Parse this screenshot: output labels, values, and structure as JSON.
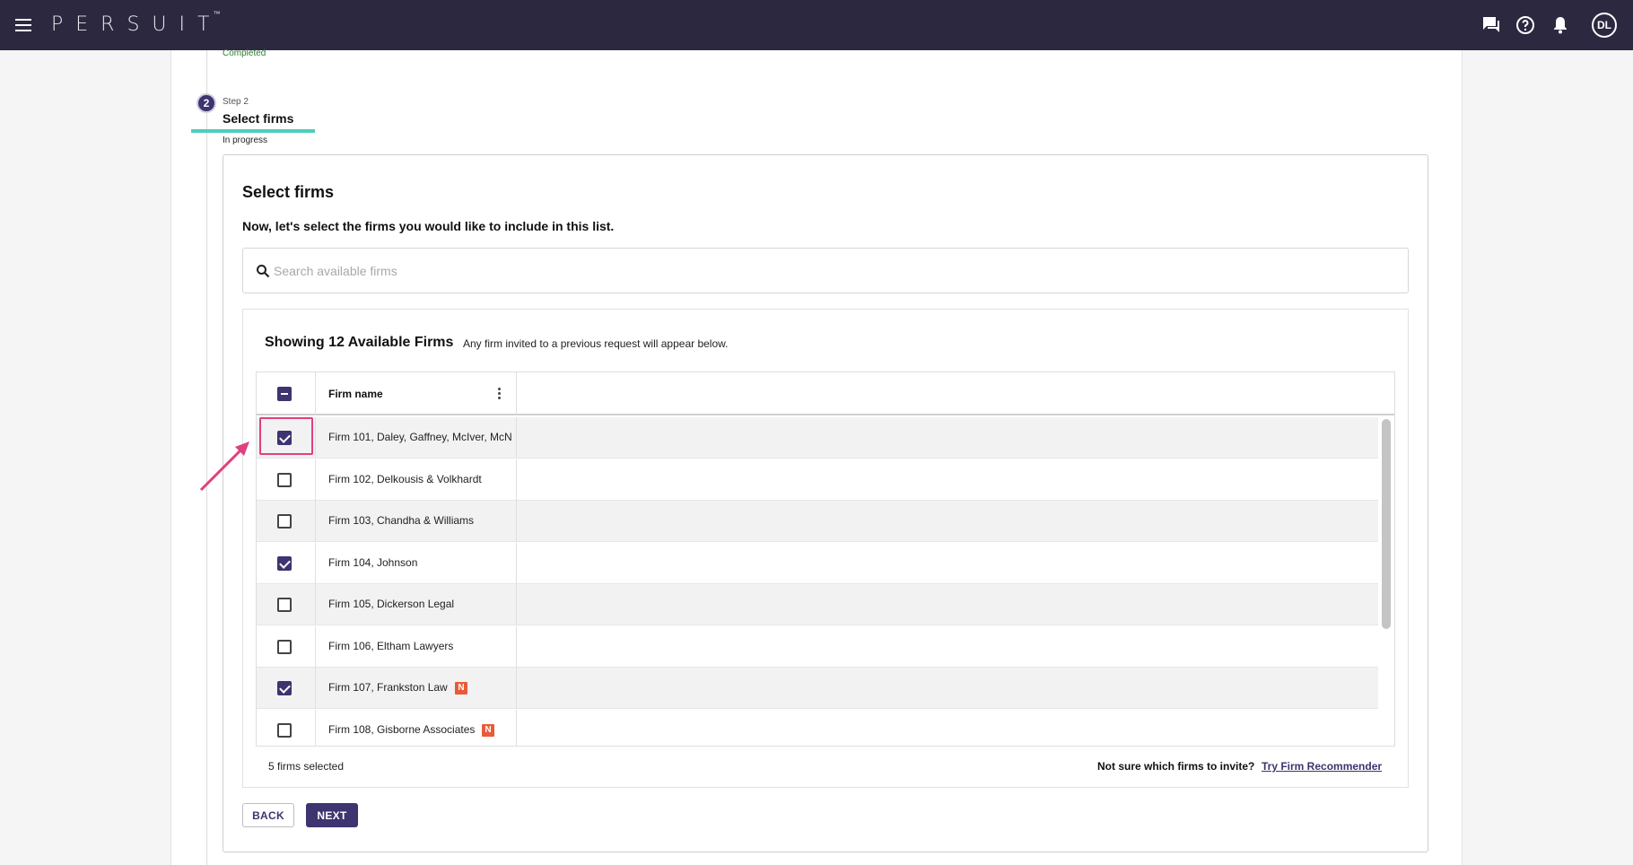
{
  "app": {
    "logo_text": "PERSUIT",
    "logo_mark": "™",
    "avatar_initials": "DL",
    "brand_color": "#2b2840",
    "accent_color": "#3d3470",
    "top_icons": [
      "chat-icon",
      "help-icon",
      "bell-icon"
    ]
  },
  "stepper": {
    "prev_status": "Completed",
    "step_number": "2",
    "step_label": "Step 2",
    "step_title": "Select firms",
    "step_status": "In progress"
  },
  "card": {
    "title": "Select firms",
    "subtitle": "Now, let's select the firms you would like to include in this list."
  },
  "search": {
    "placeholder": "Search available firms",
    "value": ""
  },
  "list": {
    "heading": "Showing 12 Available Firms",
    "note": "Any firm invited to a previous request will appear below.",
    "column_header": "Firm name",
    "select_all_state": "indeterminate",
    "rows": [
      {
        "name": "Firm 101, Daley, Gaffney, McIver, McN",
        "checked": true,
        "badge": ""
      },
      {
        "name": "Firm 102, Delkousis & Volkhardt",
        "checked": false,
        "badge": ""
      },
      {
        "name": "Firm 103, Chandha & Williams",
        "checked": false,
        "badge": ""
      },
      {
        "name": "Firm 104, Johnson",
        "checked": true,
        "badge": ""
      },
      {
        "name": "Firm 105, Dickerson Legal",
        "checked": false,
        "badge": ""
      },
      {
        "name": "Firm 106, Eltham Lawyers",
        "checked": false,
        "badge": ""
      },
      {
        "name": "Firm 107, Frankston Law",
        "checked": true,
        "badge": "N"
      },
      {
        "name": "Firm 108, Gisborne Associates",
        "checked": false,
        "badge": "N"
      }
    ]
  },
  "footer": {
    "selected_count": "5 firms selected",
    "not_sure": "Not sure which firms to invite?",
    "recommender_link": "Try Firm Recommender"
  },
  "actions": {
    "back_label": "BACK",
    "next_label": "NEXT"
  }
}
